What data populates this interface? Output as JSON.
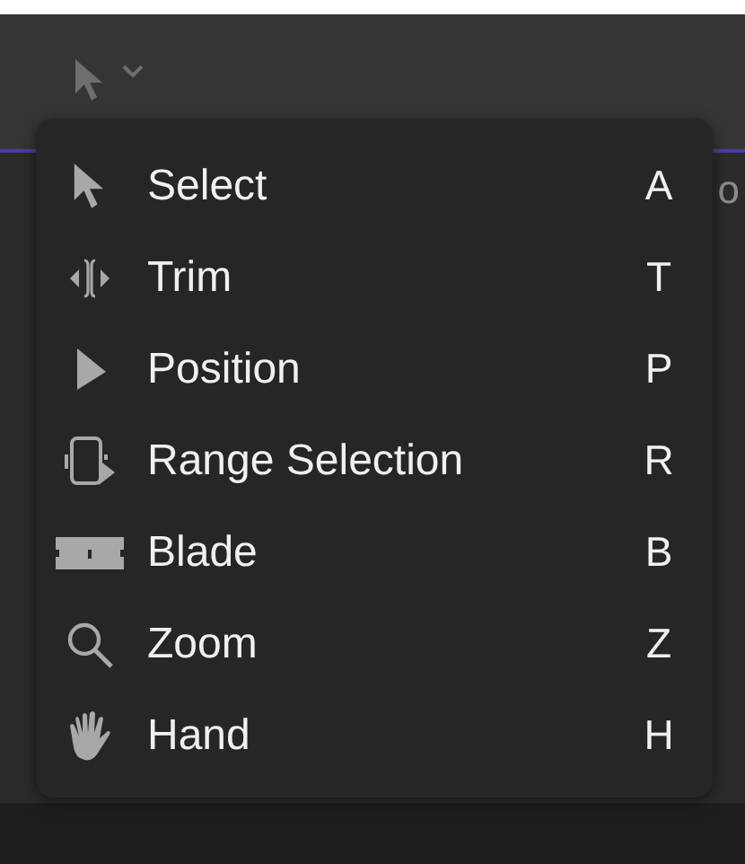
{
  "background_text": "o",
  "menu": {
    "items": [
      {
        "kind": "select",
        "label": "Select",
        "shortcut": "A"
      },
      {
        "kind": "trim",
        "label": "Trim",
        "shortcut": "T"
      },
      {
        "kind": "position",
        "label": "Position",
        "shortcut": "P"
      },
      {
        "kind": "range",
        "label": "Range Selection",
        "shortcut": "R"
      },
      {
        "kind": "blade",
        "label": "Blade",
        "shortcut": "B"
      },
      {
        "kind": "zoom",
        "label": "Zoom",
        "shortcut": "Z"
      },
      {
        "kind": "hand",
        "label": "Hand",
        "shortcut": "H"
      }
    ]
  }
}
